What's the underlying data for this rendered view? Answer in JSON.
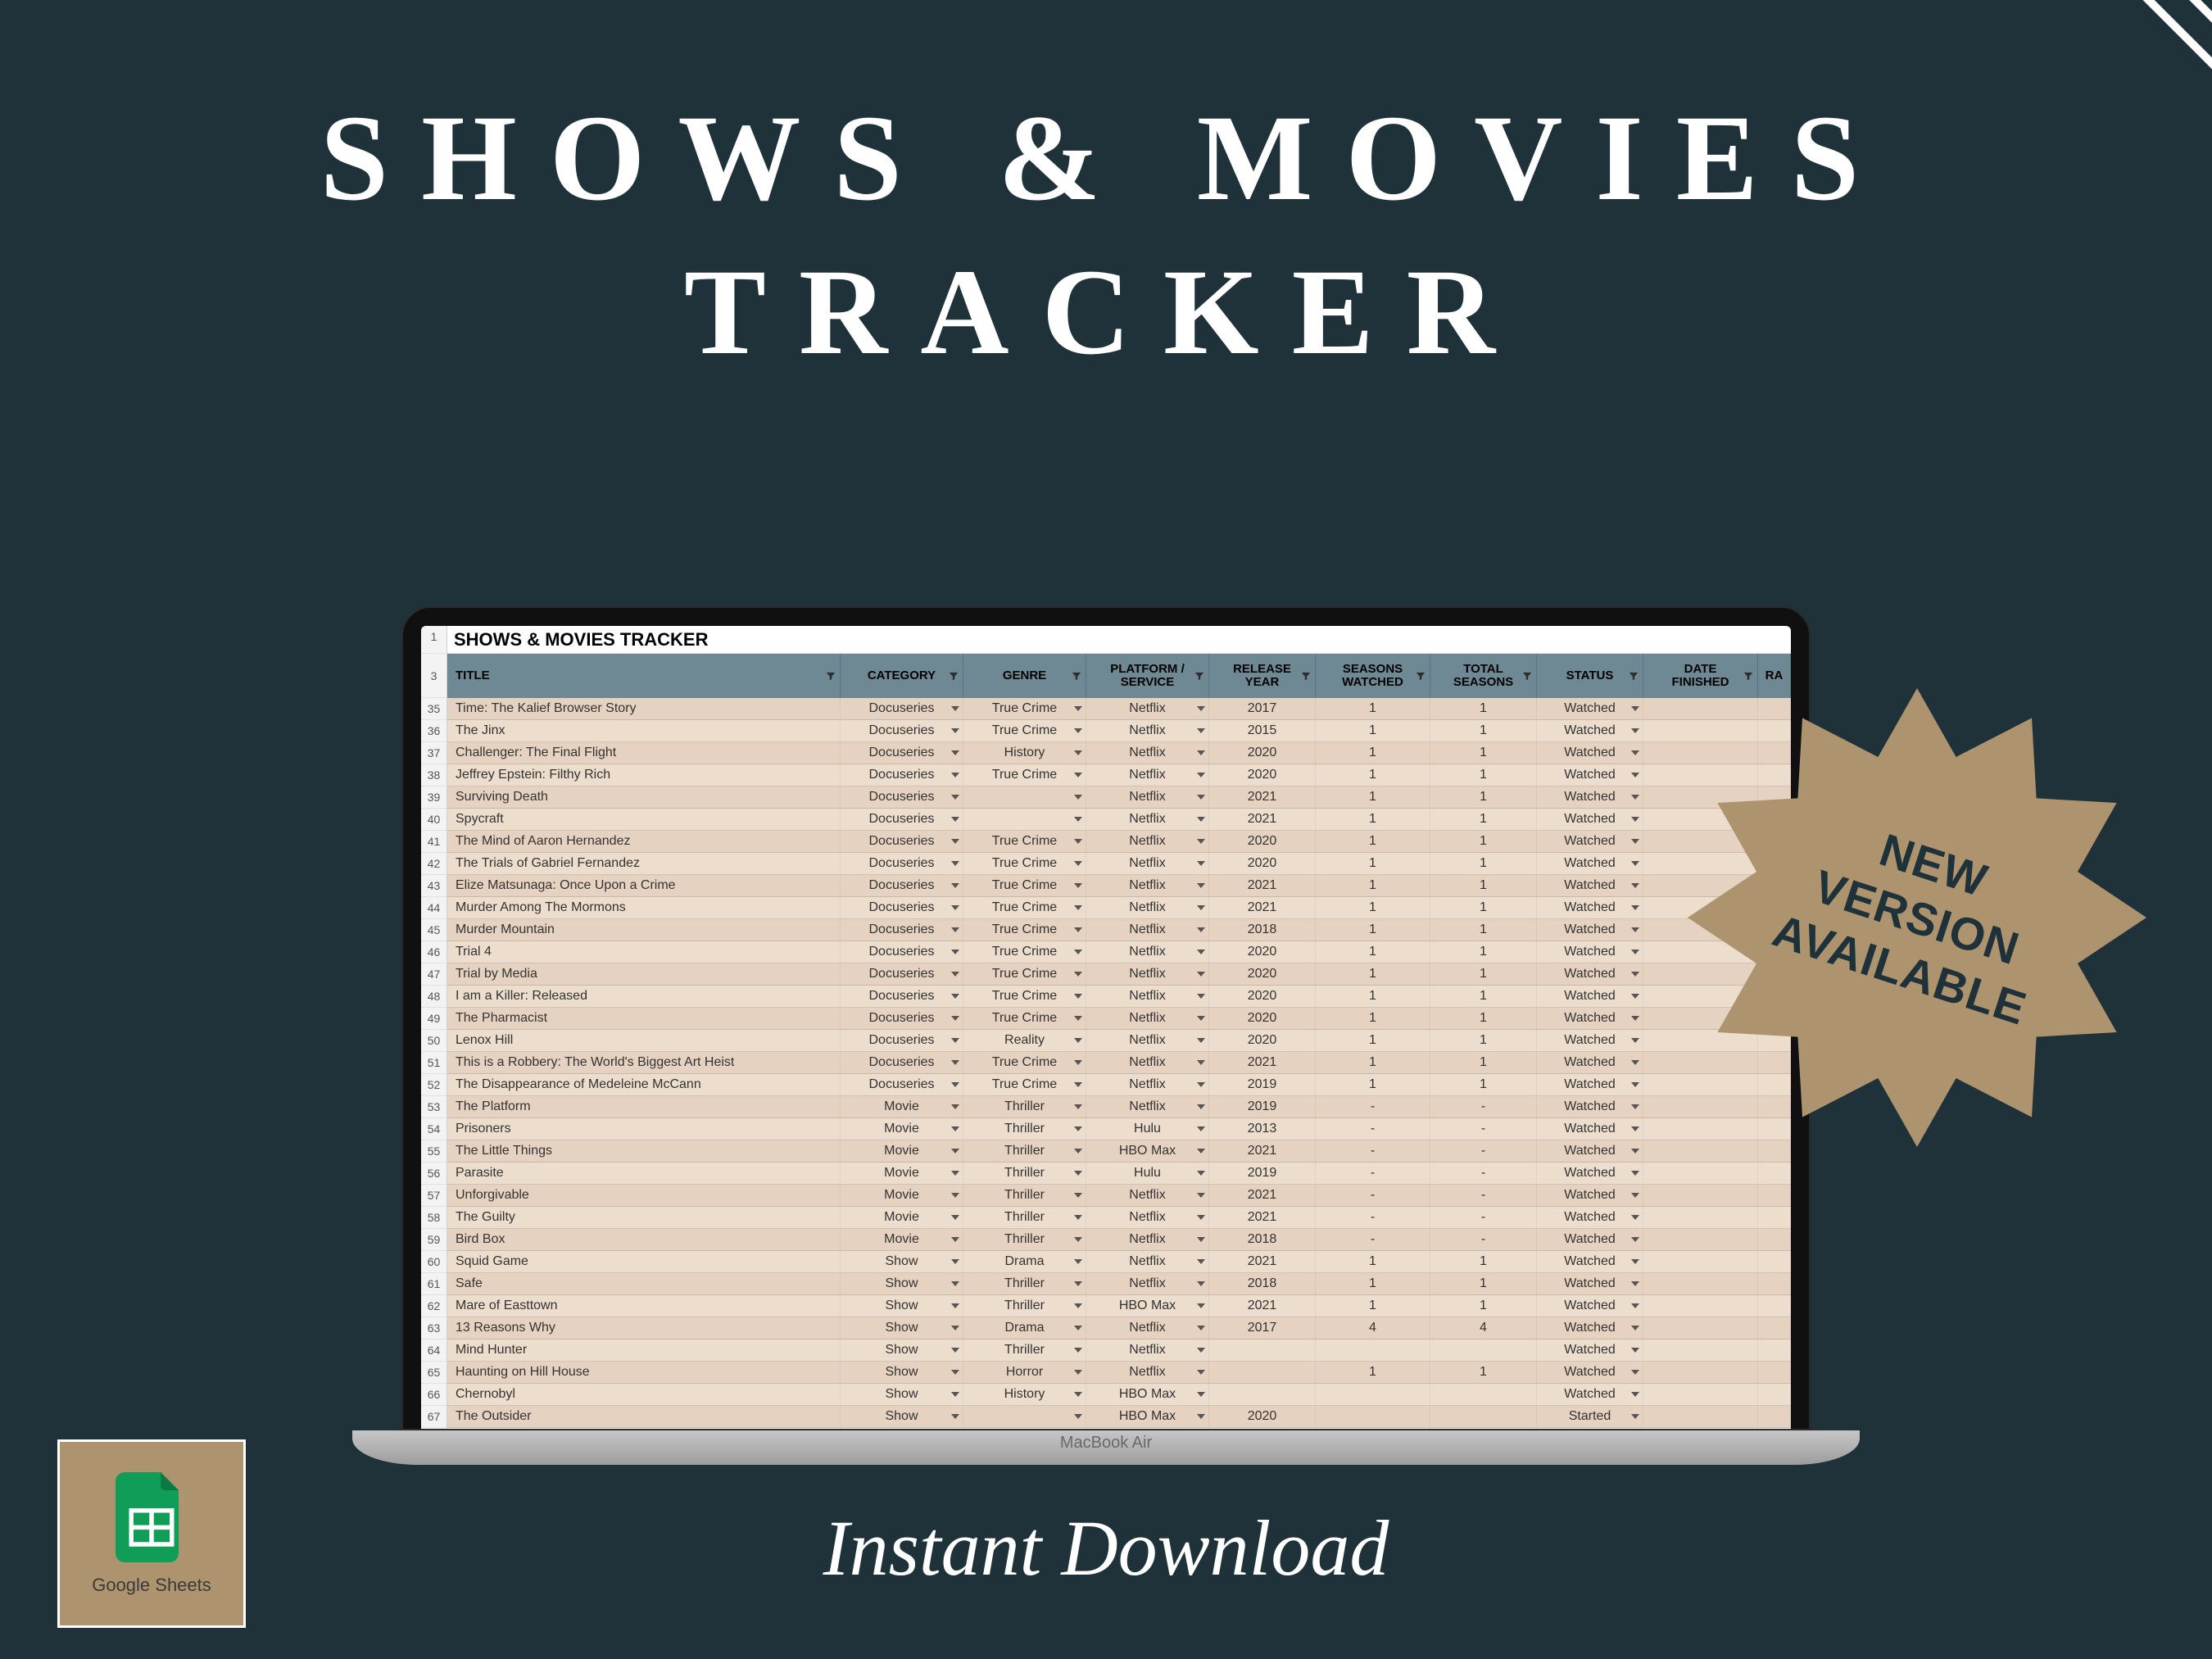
{
  "hero": {
    "title_line1": "SHOWS & MOVIES",
    "title_line2": "TRACKER"
  },
  "subtitle": "Instant Download",
  "laptop_label": "MacBook Air",
  "starburst": {
    "line1": "NEW",
    "line2": "VERSION",
    "line3": "AVAILABLE"
  },
  "badge": {
    "label": "Google Sheets"
  },
  "spreadsheet": {
    "title": "SHOWS & MOVIES TRACKER",
    "row_numbers_header": [
      "1",
      "3"
    ],
    "columns": [
      {
        "key": "title",
        "label": "TITLE"
      },
      {
        "key": "category",
        "label": "CATEGORY"
      },
      {
        "key": "genre",
        "label": "GENRE"
      },
      {
        "key": "platform",
        "label": "PLATFORM /\nSERVICE"
      },
      {
        "key": "year",
        "label": "RELEASE\nYEAR"
      },
      {
        "key": "sw",
        "label": "SEASONS\nWATCHED"
      },
      {
        "key": "ts",
        "label": "TOTAL\nSEASONS"
      },
      {
        "key": "status",
        "label": "STATUS"
      },
      {
        "key": "date",
        "label": "DATE\nFINISHED"
      },
      {
        "key": "rate",
        "label": "RA"
      }
    ],
    "rows": [
      {
        "n": "35",
        "title": "Time: The Kalief Browser Story",
        "category": "Docuseries",
        "genre": "True Crime",
        "platform": "Netflix",
        "year": "2017",
        "sw": "1",
        "ts": "1",
        "status": "Watched",
        "date": ""
      },
      {
        "n": "36",
        "title": "The Jinx",
        "category": "Docuseries",
        "genre": "True Crime",
        "platform": "Netflix",
        "year": "2015",
        "sw": "1",
        "ts": "1",
        "status": "Watched",
        "date": ""
      },
      {
        "n": "37",
        "title": "Challenger: The Final Flight",
        "category": "Docuseries",
        "genre": "History",
        "platform": "Netflix",
        "year": "2020",
        "sw": "1",
        "ts": "1",
        "status": "Watched",
        "date": ""
      },
      {
        "n": "38",
        "title": "Jeffrey Epstein: Filthy Rich",
        "category": "Docuseries",
        "genre": "True Crime",
        "platform": "Netflix",
        "year": "2020",
        "sw": "1",
        "ts": "1",
        "status": "Watched",
        "date": ""
      },
      {
        "n": "39",
        "title": "Surviving Death",
        "category": "Docuseries",
        "genre": "",
        "platform": "Netflix",
        "year": "2021",
        "sw": "1",
        "ts": "1",
        "status": "Watched",
        "date": ""
      },
      {
        "n": "40",
        "title": "Spycraft",
        "category": "Docuseries",
        "genre": "",
        "platform": "Netflix",
        "year": "2021",
        "sw": "1",
        "ts": "1",
        "status": "Watched",
        "date": ""
      },
      {
        "n": "41",
        "title": "The Mind of Aaron Hernandez",
        "category": "Docuseries",
        "genre": "True Crime",
        "platform": "Netflix",
        "year": "2020",
        "sw": "1",
        "ts": "1",
        "status": "Watched",
        "date": ""
      },
      {
        "n": "42",
        "title": "The Trials of Gabriel Fernandez",
        "category": "Docuseries",
        "genre": "True Crime",
        "platform": "Netflix",
        "year": "2020",
        "sw": "1",
        "ts": "1",
        "status": "Watched",
        "date": ""
      },
      {
        "n": "43",
        "title": "Elize Matsunaga: Once Upon a Crime",
        "category": "Docuseries",
        "genre": "True Crime",
        "platform": "Netflix",
        "year": "2021",
        "sw": "1",
        "ts": "1",
        "status": "Watched",
        "date": ""
      },
      {
        "n": "44",
        "title": "Murder Among The Mormons",
        "category": "Docuseries",
        "genre": "True Crime",
        "platform": "Netflix",
        "year": "2021",
        "sw": "1",
        "ts": "1",
        "status": "Watched",
        "date": ""
      },
      {
        "n": "45",
        "title": "Murder Mountain",
        "category": "Docuseries",
        "genre": "True Crime",
        "platform": "Netflix",
        "year": "2018",
        "sw": "1",
        "ts": "1",
        "status": "Watched",
        "date": ""
      },
      {
        "n": "46",
        "title": "Trial 4",
        "category": "Docuseries",
        "genre": "True Crime",
        "platform": "Netflix",
        "year": "2020",
        "sw": "1",
        "ts": "1",
        "status": "Watched",
        "date": ""
      },
      {
        "n": "47",
        "title": "Trial by Media",
        "category": "Docuseries",
        "genre": "True Crime",
        "platform": "Netflix",
        "year": "2020",
        "sw": "1",
        "ts": "1",
        "status": "Watched",
        "date": ""
      },
      {
        "n": "48",
        "title": "I am a Killer: Released",
        "category": "Docuseries",
        "genre": "True Crime",
        "platform": "Netflix",
        "year": "2020",
        "sw": "1",
        "ts": "1",
        "status": "Watched",
        "date": ""
      },
      {
        "n": "49",
        "title": "The Pharmacist",
        "category": "Docuseries",
        "genre": "True Crime",
        "platform": "Netflix",
        "year": "2020",
        "sw": "1",
        "ts": "1",
        "status": "Watched",
        "date": ""
      },
      {
        "n": "50",
        "title": "Lenox Hill",
        "category": "Docuseries",
        "genre": "Reality",
        "platform": "Netflix",
        "year": "2020",
        "sw": "1",
        "ts": "1",
        "status": "Watched",
        "date": ""
      },
      {
        "n": "51",
        "title": "This is a Robbery: The World's Biggest Art Heist",
        "category": "Docuseries",
        "genre": "True Crime",
        "platform": "Netflix",
        "year": "2021",
        "sw": "1",
        "ts": "1",
        "status": "Watched",
        "date": ""
      },
      {
        "n": "52",
        "title": "The Disappearance of Medeleine McCann",
        "category": "Docuseries",
        "genre": "True Crime",
        "platform": "Netflix",
        "year": "2019",
        "sw": "1",
        "ts": "1",
        "status": "Watched",
        "date": ""
      },
      {
        "n": "53",
        "title": "The Platform",
        "category": "Movie",
        "genre": "Thriller",
        "platform": "Netflix",
        "year": "2019",
        "sw": "-",
        "ts": "-",
        "status": "Watched",
        "date": ""
      },
      {
        "n": "54",
        "title": "Prisoners",
        "category": "Movie",
        "genre": "Thriller",
        "platform": "Hulu",
        "year": "2013",
        "sw": "-",
        "ts": "-",
        "status": "Watched",
        "date": ""
      },
      {
        "n": "55",
        "title": "The Little Things",
        "category": "Movie",
        "genre": "Thriller",
        "platform": "HBO Max",
        "year": "2021",
        "sw": "-",
        "ts": "-",
        "status": "Watched",
        "date": ""
      },
      {
        "n": "56",
        "title": "Parasite",
        "category": "Movie",
        "genre": "Thriller",
        "platform": "Hulu",
        "year": "2019",
        "sw": "-",
        "ts": "-",
        "status": "Watched",
        "date": ""
      },
      {
        "n": "57",
        "title": "Unforgivable",
        "category": "Movie",
        "genre": "Thriller",
        "platform": "Netflix",
        "year": "2021",
        "sw": "-",
        "ts": "-",
        "status": "Watched",
        "date": ""
      },
      {
        "n": "58",
        "title": "The Guilty",
        "category": "Movie",
        "genre": "Thriller",
        "platform": "Netflix",
        "year": "2021",
        "sw": "-",
        "ts": "-",
        "status": "Watched",
        "date": ""
      },
      {
        "n": "59",
        "title": "Bird Box",
        "category": "Movie",
        "genre": "Thriller",
        "platform": "Netflix",
        "year": "2018",
        "sw": "-",
        "ts": "-",
        "status": "Watched",
        "date": ""
      },
      {
        "n": "60",
        "title": "Squid Game",
        "category": "Show",
        "genre": "Drama",
        "platform": "Netflix",
        "year": "2021",
        "sw": "1",
        "ts": "1",
        "status": "Watched",
        "date": ""
      },
      {
        "n": "61",
        "title": "Safe",
        "category": "Show",
        "genre": "Thriller",
        "platform": "Netflix",
        "year": "2018",
        "sw": "1",
        "ts": "1",
        "status": "Watched",
        "date": ""
      },
      {
        "n": "62",
        "title": "Mare of Easttown",
        "category": "Show",
        "genre": "Thriller",
        "platform": "HBO Max",
        "year": "2021",
        "sw": "1",
        "ts": "1",
        "status": "Watched",
        "date": ""
      },
      {
        "n": "63",
        "title": "13 Reasons Why",
        "category": "Show",
        "genre": "Drama",
        "platform": "Netflix",
        "year": "2017",
        "sw": "4",
        "ts": "4",
        "status": "Watched",
        "date": ""
      },
      {
        "n": "64",
        "title": "Mind Hunter",
        "category": "Show",
        "genre": "Thriller",
        "platform": "Netflix",
        "year": "",
        "sw": "",
        "ts": "",
        "status": "Watched",
        "date": ""
      },
      {
        "n": "65",
        "title": "Haunting on Hill House",
        "category": "Show",
        "genre": "Horror",
        "platform": "Netflix",
        "year": "",
        "sw": "1",
        "ts": "1",
        "status": "Watched",
        "date": ""
      },
      {
        "n": "66",
        "title": "Chernobyl",
        "category": "Show",
        "genre": "History",
        "platform": "HBO Max",
        "year": "",
        "sw": "",
        "ts": "",
        "status": "Watched",
        "date": ""
      },
      {
        "n": "67",
        "title": "The Outsider",
        "category": "Show",
        "genre": "",
        "platform": "HBO Max",
        "year": "2020",
        "sw": "",
        "ts": "",
        "status": "Started",
        "date": ""
      }
    ]
  }
}
